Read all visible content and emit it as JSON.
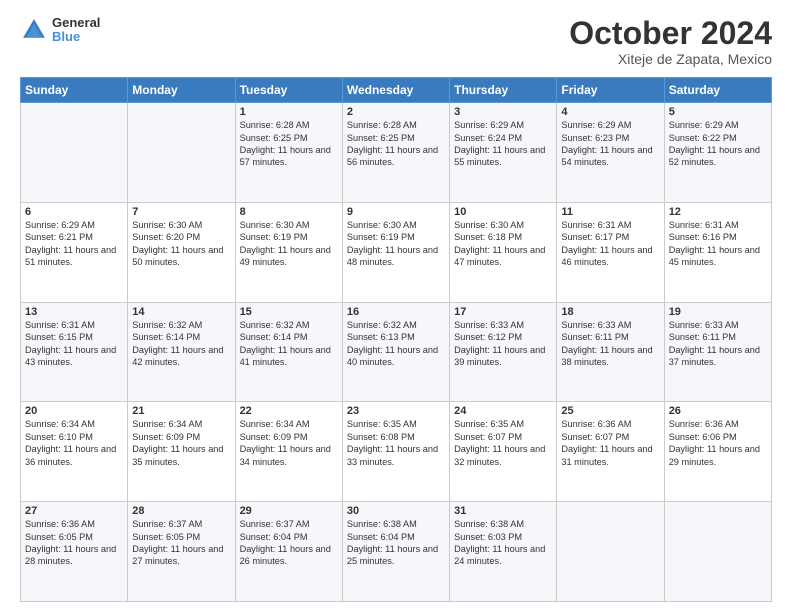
{
  "header": {
    "logo_line1": "General",
    "logo_line2": "Blue",
    "title": "October 2024",
    "subtitle": "Xiteje de Zapata, Mexico"
  },
  "days_of_week": [
    "Sunday",
    "Monday",
    "Tuesday",
    "Wednesday",
    "Thursday",
    "Friday",
    "Saturday"
  ],
  "weeks": [
    [
      {
        "day": "",
        "text": ""
      },
      {
        "day": "",
        "text": ""
      },
      {
        "day": "1",
        "text": "Sunrise: 6:28 AM\nSunset: 6:25 PM\nDaylight: 11 hours and 57 minutes."
      },
      {
        "day": "2",
        "text": "Sunrise: 6:28 AM\nSunset: 6:25 PM\nDaylight: 11 hours and 56 minutes."
      },
      {
        "day": "3",
        "text": "Sunrise: 6:29 AM\nSunset: 6:24 PM\nDaylight: 11 hours and 55 minutes."
      },
      {
        "day": "4",
        "text": "Sunrise: 6:29 AM\nSunset: 6:23 PM\nDaylight: 11 hours and 54 minutes."
      },
      {
        "day": "5",
        "text": "Sunrise: 6:29 AM\nSunset: 6:22 PM\nDaylight: 11 hours and 52 minutes."
      }
    ],
    [
      {
        "day": "6",
        "text": "Sunrise: 6:29 AM\nSunset: 6:21 PM\nDaylight: 11 hours and 51 minutes."
      },
      {
        "day": "7",
        "text": "Sunrise: 6:30 AM\nSunset: 6:20 PM\nDaylight: 11 hours and 50 minutes."
      },
      {
        "day": "8",
        "text": "Sunrise: 6:30 AM\nSunset: 6:19 PM\nDaylight: 11 hours and 49 minutes."
      },
      {
        "day": "9",
        "text": "Sunrise: 6:30 AM\nSunset: 6:19 PM\nDaylight: 11 hours and 48 minutes."
      },
      {
        "day": "10",
        "text": "Sunrise: 6:30 AM\nSunset: 6:18 PM\nDaylight: 11 hours and 47 minutes."
      },
      {
        "day": "11",
        "text": "Sunrise: 6:31 AM\nSunset: 6:17 PM\nDaylight: 11 hours and 46 minutes."
      },
      {
        "day": "12",
        "text": "Sunrise: 6:31 AM\nSunset: 6:16 PM\nDaylight: 11 hours and 45 minutes."
      }
    ],
    [
      {
        "day": "13",
        "text": "Sunrise: 6:31 AM\nSunset: 6:15 PM\nDaylight: 11 hours and 43 minutes."
      },
      {
        "day": "14",
        "text": "Sunrise: 6:32 AM\nSunset: 6:14 PM\nDaylight: 11 hours and 42 minutes."
      },
      {
        "day": "15",
        "text": "Sunrise: 6:32 AM\nSunset: 6:14 PM\nDaylight: 11 hours and 41 minutes."
      },
      {
        "day": "16",
        "text": "Sunrise: 6:32 AM\nSunset: 6:13 PM\nDaylight: 11 hours and 40 minutes."
      },
      {
        "day": "17",
        "text": "Sunrise: 6:33 AM\nSunset: 6:12 PM\nDaylight: 11 hours and 39 minutes."
      },
      {
        "day": "18",
        "text": "Sunrise: 6:33 AM\nSunset: 6:11 PM\nDaylight: 11 hours and 38 minutes."
      },
      {
        "day": "19",
        "text": "Sunrise: 6:33 AM\nSunset: 6:11 PM\nDaylight: 11 hours and 37 minutes."
      }
    ],
    [
      {
        "day": "20",
        "text": "Sunrise: 6:34 AM\nSunset: 6:10 PM\nDaylight: 11 hours and 36 minutes."
      },
      {
        "day": "21",
        "text": "Sunrise: 6:34 AM\nSunset: 6:09 PM\nDaylight: 11 hours and 35 minutes."
      },
      {
        "day": "22",
        "text": "Sunrise: 6:34 AM\nSunset: 6:09 PM\nDaylight: 11 hours and 34 minutes."
      },
      {
        "day": "23",
        "text": "Sunrise: 6:35 AM\nSunset: 6:08 PM\nDaylight: 11 hours and 33 minutes."
      },
      {
        "day": "24",
        "text": "Sunrise: 6:35 AM\nSunset: 6:07 PM\nDaylight: 11 hours and 32 minutes."
      },
      {
        "day": "25",
        "text": "Sunrise: 6:36 AM\nSunset: 6:07 PM\nDaylight: 11 hours and 31 minutes."
      },
      {
        "day": "26",
        "text": "Sunrise: 6:36 AM\nSunset: 6:06 PM\nDaylight: 11 hours and 29 minutes."
      }
    ],
    [
      {
        "day": "27",
        "text": "Sunrise: 6:36 AM\nSunset: 6:05 PM\nDaylight: 11 hours and 28 minutes."
      },
      {
        "day": "28",
        "text": "Sunrise: 6:37 AM\nSunset: 6:05 PM\nDaylight: 11 hours and 27 minutes."
      },
      {
        "day": "29",
        "text": "Sunrise: 6:37 AM\nSunset: 6:04 PM\nDaylight: 11 hours and 26 minutes."
      },
      {
        "day": "30",
        "text": "Sunrise: 6:38 AM\nSunset: 6:04 PM\nDaylight: 11 hours and 25 minutes."
      },
      {
        "day": "31",
        "text": "Sunrise: 6:38 AM\nSunset: 6:03 PM\nDaylight: 11 hours and 24 minutes."
      },
      {
        "day": "",
        "text": ""
      },
      {
        "day": "",
        "text": ""
      }
    ]
  ]
}
